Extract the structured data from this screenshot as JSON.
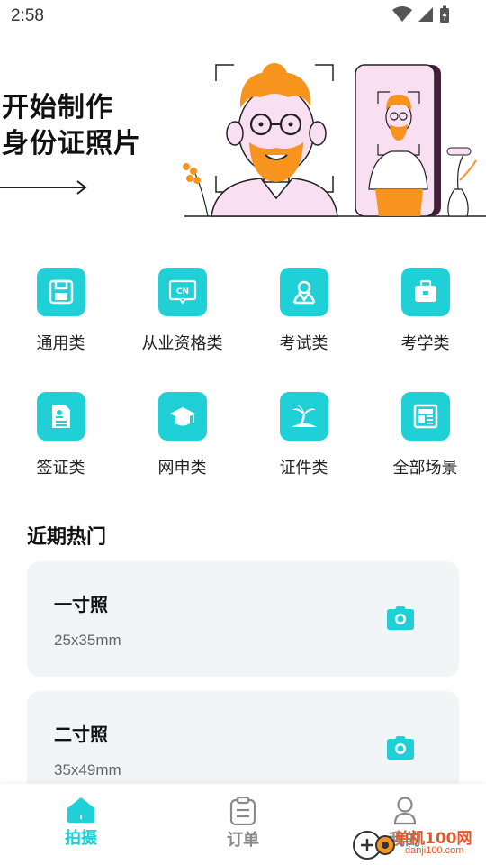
{
  "status_bar": {
    "time": "2:58"
  },
  "hero": {
    "title_line1": "开始制作",
    "title_line2": "身份证照片"
  },
  "categories": [
    {
      "label": "通用类",
      "icon": "save-icon"
    },
    {
      "label": "从业资格类",
      "icon": "cn-badge-icon"
    },
    {
      "label": "考试类",
      "icon": "person-pin-icon"
    },
    {
      "label": "考学类",
      "icon": "briefcase-icon"
    },
    {
      "label": "签证类",
      "icon": "document-icon"
    },
    {
      "label": "网申类",
      "icon": "graduation-cap-icon"
    },
    {
      "label": "证件类",
      "icon": "palm-island-icon"
    },
    {
      "label": "全部场景",
      "icon": "grid-layout-icon"
    }
  ],
  "recent": {
    "title": "近期热门",
    "items": [
      {
        "name": "一寸照",
        "size": "25x35mm"
      },
      {
        "name": "二寸照",
        "size": "35x49mm"
      }
    ]
  },
  "bottom_nav": {
    "items": [
      {
        "label": "拍摄",
        "active": true
      },
      {
        "label": "订单",
        "active": false
      },
      {
        "label": "我的",
        "active": false
      }
    ]
  },
  "watermark": {
    "text": "单机100网",
    "url": "danji100.com"
  },
  "colors": {
    "accent": "#1fd0d6",
    "hero_orange": "#f7941d",
    "hero_pink": "#f9dff2"
  }
}
